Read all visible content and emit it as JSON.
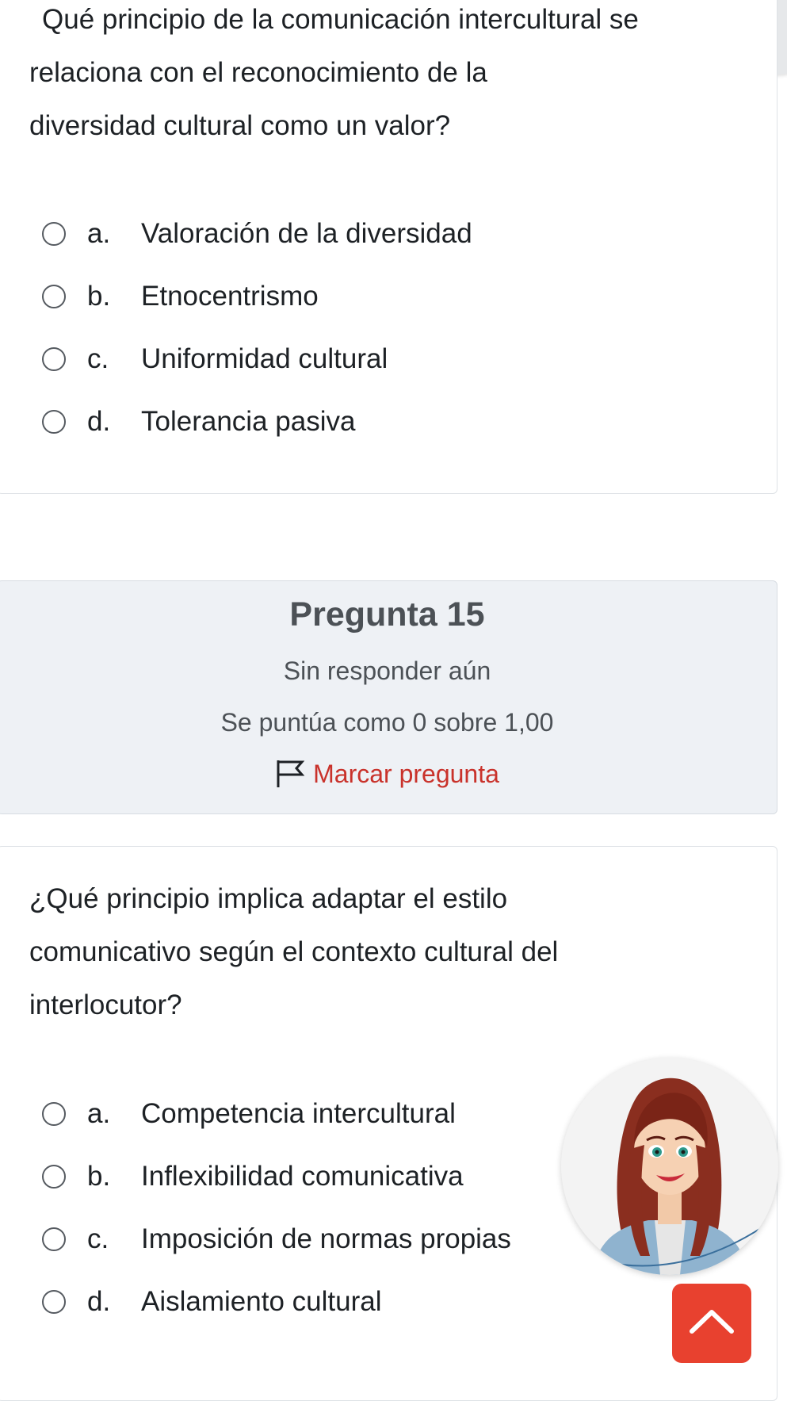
{
  "prev_question": {
    "text_lines": [
      "Qué principio de la comunicación intercultural se",
      "relaciona con el reconocimiento de la",
      "diversidad cultural como un valor?"
    ],
    "options": [
      {
        "letter": "a.",
        "text": "Valoración de la diversidad"
      },
      {
        "letter": "b.",
        "text": "Etnocentrismo"
      },
      {
        "letter": "c.",
        "text": "Uniformidad cultural"
      },
      {
        "letter": "d.",
        "text": "Tolerancia pasiva"
      }
    ]
  },
  "question_info": {
    "title": "Pregunta 15",
    "status": "Sin responder aún",
    "grade": "Se puntúa como 0 sobre 1,00",
    "flag_label": "Marcar pregunta"
  },
  "question15": {
    "text_lines": [
      "¿Qué principio implica adaptar el estilo",
      "comunicativo según el contexto cultural del",
      "interlocutor?"
    ],
    "options": [
      {
        "letter": "a.",
        "text": "Competencia intercultural"
      },
      {
        "letter": "b.",
        "text": "Inflexibilidad comunicativa"
      },
      {
        "letter": "c.",
        "text": "Imposición de normas propias"
      },
      {
        "letter": "d.",
        "text": "Aislamiento cultural"
      }
    ]
  },
  "icons": {
    "menu": "menu-icon",
    "back": "chevron-left-icon",
    "flag": "flag-icon",
    "scroll_top": "chevron-up-icon",
    "avatar": "assistant-avatar"
  },
  "colors": {
    "flag_accent": "#c9322b",
    "scroll_button": "#e8412f",
    "info_background": "#eef1f5"
  }
}
